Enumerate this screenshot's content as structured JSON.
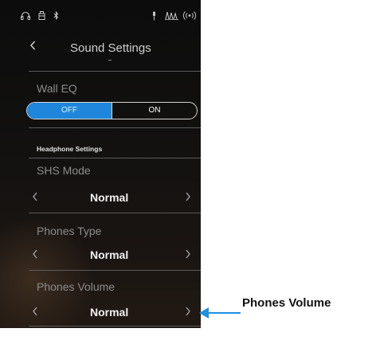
{
  "status_bar": {
    "icons": [
      "headphone-icon",
      "usb-icon",
      "bluetooth-icon",
      "mic-icon",
      "metronome-icon",
      "wireless-icon"
    ]
  },
  "header": {
    "back_icon": "chevron-left-icon",
    "title": "Sound Settings"
  },
  "wall_eq": {
    "label": "Wall EQ",
    "options": [
      "OFF",
      "ON"
    ],
    "selected": "OFF",
    "accent_color": "#1f87db"
  },
  "headphone_section": {
    "title": "Headphone Settings",
    "settings": [
      {
        "label": "SHS Mode",
        "value": "Normal"
      },
      {
        "label": "Phones Type",
        "value": "Normal"
      },
      {
        "label": "Phones Volume",
        "value": "Normal"
      }
    ]
  },
  "callout": {
    "label": "Phones Volume",
    "color": "#1f8fe0"
  }
}
